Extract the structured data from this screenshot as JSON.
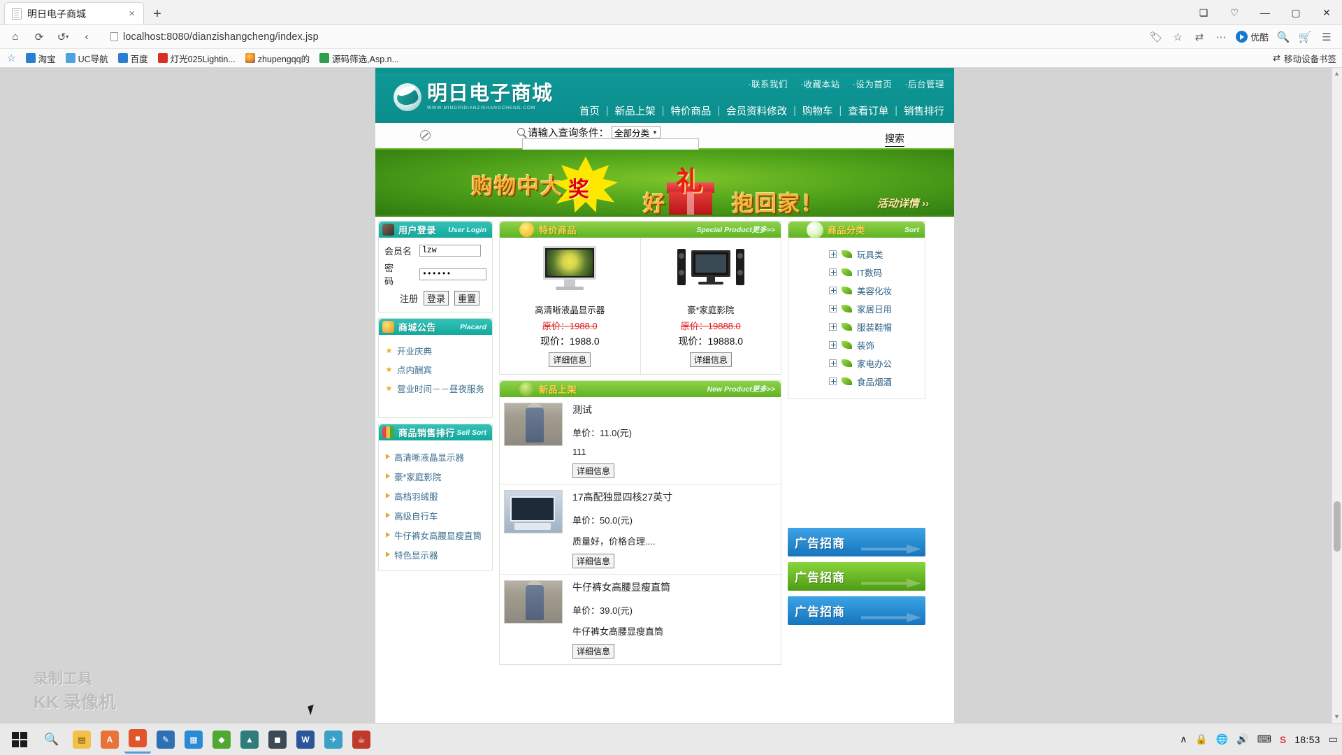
{
  "browser": {
    "tab": {
      "title": "明日电子商城",
      "close": "×"
    },
    "new_tab": "+",
    "window_controls": {
      "restore_down": "❐",
      "minimize": "—",
      "maximize": "▢",
      "close": "✕",
      "split": "❏",
      "fav": "♡"
    },
    "nav": {
      "home": "⌂",
      "reload": "⟳",
      "history": "↶",
      "back": "‹",
      "forward": "›"
    },
    "url": "localhost:8080/dianzishangcheng/index.jsp",
    "omnibox_icons": {
      "coupon": "🏷",
      "star": "☆",
      "translate": "⇄",
      "more": "⋯",
      "search": "🔍",
      "cart": "🛒",
      "menu": "☰"
    },
    "youku_label": "优酷",
    "bookmarks": [
      {
        "label": "淘宝",
        "color": "#2b7fd1"
      },
      {
        "label": "UC导航",
        "color": "#4aa3df"
      },
      {
        "label": "百度",
        "color": "#2b7fd1"
      },
      {
        "label": "灯光025Lightin...",
        "color": "#d93025"
      },
      {
        "label": "zhupengqq的",
        "color": "#f0a020"
      },
      {
        "label": "源码筛选,Asp.n...",
        "color": "#2e9e4f"
      }
    ],
    "bookmarks_right": {
      "label": "移动设备书签",
      "icon": "⇄"
    }
  },
  "site": {
    "top_links": [
      "·联系我们",
      "·收藏本站",
      "·设为首页",
      "·后台管理"
    ],
    "logo_cn": "明日电子商城",
    "logo_en": "WWW.MINGRIDIANZISHANGCHENG.COM",
    "main_nav": [
      "首页",
      "新品上架",
      "特价商品",
      "会员资料修改",
      "购物车",
      "查看订单",
      "销售排行"
    ],
    "nav_separator": "|",
    "search": {
      "label": "请输入查询条件：",
      "category_selected": "全部分类",
      "caret": "▼",
      "input_value": "",
      "button": "搜索"
    },
    "banner": {
      "line1": "购物中大",
      "star_word": "奖",
      "line2": "好",
      "gift_word": "礼",
      "line3": "抱回家！",
      "detail": "活动详情 ››"
    }
  },
  "login": {
    "title_cn": "用户登录",
    "title_en": "User Login",
    "label_user": "会员名",
    "label_pass": "密 码",
    "value_user": "lzw",
    "value_pass": "••••••",
    "btn_register": "注册",
    "btn_login": "登录",
    "btn_reset": "重置"
  },
  "placard": {
    "title_cn": "商城公告",
    "title_en": "Placard",
    "items": [
      "开业庆典",
      "点内酬宾",
      "营业时间－－昼夜服务"
    ]
  },
  "sellsort": {
    "title_cn": "商品销售排行",
    "title_en": "Sell Sort",
    "items": [
      "高清晰液晶显示器",
      "豪*家庭影院",
      "高档羽绒服",
      "高级自行车",
      "牛仔裤女高腰显瘦直筒",
      "特色显示器"
    ]
  },
  "special": {
    "title_cn": "特价商品",
    "title_en": "Special Product",
    "more": "更多>>",
    "products": [
      {
        "name": "高清晰液晶显示器",
        "old_label": "原价：",
        "old_price": "1988.0",
        "new_label": "现价：",
        "new_price": "1988.0",
        "detail": "详细信息",
        "img": "monitor"
      },
      {
        "name": "豪*家庭影院",
        "old_label": "原价：",
        "old_price": "19888.0",
        "new_label": "现价：",
        "new_price": "19888.0",
        "detail": "详细信息",
        "img": "hts"
      }
    ]
  },
  "newproduct": {
    "title_cn": "新品上架",
    "title_en": "New Product",
    "more": "更多>>",
    "rows": [
      {
        "title": "测试",
        "price": "单价：11.0(元)",
        "desc": "111",
        "detail": "详细信息",
        "img": "jeans"
      },
      {
        "title": "17高配独显四核27英寸",
        "price": "单价：50.0(元)",
        "desc": "质量好，价格合理....",
        "detail": "详细信息",
        "img": "desk"
      },
      {
        "title": "牛仔裤女高腰显瘦直筒",
        "price": "单价：39.0(元)",
        "desc": "牛仔裤女高腰显瘦直筒",
        "detail": "详细信息",
        "img": "jeans"
      }
    ]
  },
  "category": {
    "title_cn": "商品分类",
    "title_en": "Sort",
    "items": [
      "玩具类",
      "IT数码",
      "美容化妆",
      "家居日用",
      "服装鞋帽",
      "装饰",
      "家电办公",
      "食品烟酒"
    ]
  },
  "ads": [
    {
      "label": "广告招商",
      "style": "blue"
    },
    {
      "label": "广告招商",
      "style": "green"
    },
    {
      "label": "广告招商",
      "style": "blue"
    }
  ],
  "watermark": {
    "line1": "录制工具",
    "line2": "KK 录像机"
  },
  "taskbar": {
    "items": [
      {
        "name": "file-explorer",
        "glyph": "📁",
        "color": "#f5c04a"
      },
      {
        "name": "app-orange-a",
        "glyph": "A",
        "color": "#e8733a"
      },
      {
        "name": "app-orange-b",
        "glyph": "■",
        "color": "#e2552b"
      },
      {
        "name": "app-blue-a",
        "glyph": "✎",
        "color": "#2f6fb5"
      },
      {
        "name": "app-blue-b",
        "glyph": "▦",
        "color": "#2a8ad4"
      },
      {
        "name": "app-green",
        "glyph": "◆",
        "color": "#4fa832"
      },
      {
        "name": "app-teal",
        "glyph": "▲",
        "color": "#2f7d7a"
      },
      {
        "name": "app-dark",
        "glyph": "◼",
        "color": "#3b4a55"
      },
      {
        "name": "app-word",
        "glyph": "W",
        "color": "#2b579a"
      },
      {
        "name": "app-cyan",
        "glyph": "✈",
        "color": "#3aa0c8"
      },
      {
        "name": "app-coffee",
        "glyph": "☕",
        "color": "#c0392b"
      }
    ],
    "tray": [
      "∧",
      "🔒",
      "🌐",
      "🔊",
      "⌨",
      "S"
    ],
    "clock": "18:53",
    "notifications": "▭"
  }
}
